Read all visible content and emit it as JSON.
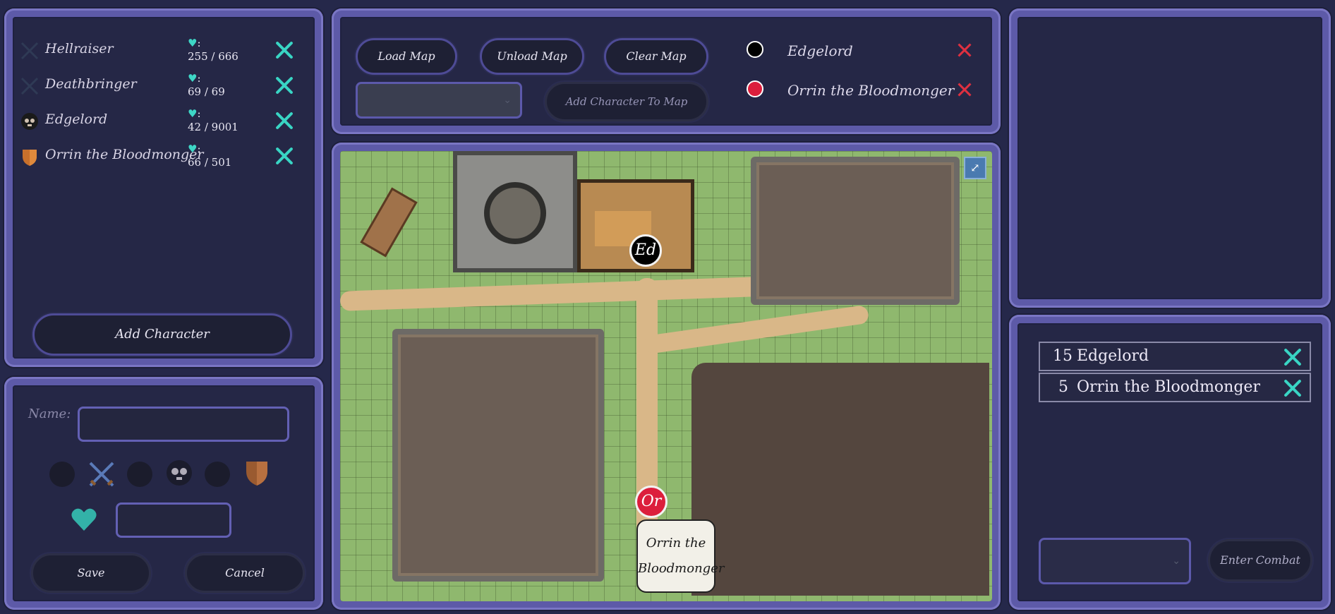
{
  "roster": {
    "items": [
      {
        "name": "Hellraiser",
        "hp_current": "255 / 666",
        "icon": "crossed-swords-icon",
        "hp_label": ":"
      },
      {
        "name": "Deathbringer",
        "hp_current": "69 / 69",
        "icon": "crossed-swords-icon",
        "hp_label": ":"
      },
      {
        "name": "Edgelord",
        "hp_current": "42 / 9001",
        "icon": "skull-icon",
        "hp_label": ":"
      },
      {
        "name": "Orrin the Bloodmonger",
        "hp_current": "66 / 501",
        "icon": "shield-icon",
        "hp_label": ":"
      }
    ],
    "add_button": "Add Character"
  },
  "editor": {
    "name_label": "Name:",
    "name_value": "",
    "hp_value": "",
    "save_label": "Save",
    "cancel_label": "Cancel",
    "icon_options": [
      "circle",
      "crossed-swords-icon",
      "circle",
      "skull-icon",
      "circle",
      "shield-icon"
    ]
  },
  "map_controls": {
    "load_label": "Load Map",
    "unload_label": "Unload Map",
    "clear_label": "Clear Map",
    "select_value": "",
    "add_to_map_label": "Add Character To Map",
    "placed": [
      {
        "name": "Edgelord",
        "color": "#000000"
      },
      {
        "name": "Orrin the Bloodmonger",
        "color": "#dc1e3c"
      }
    ]
  },
  "map": {
    "tokens": [
      {
        "label": "Ed",
        "color": "#000000"
      },
      {
        "label": "Or",
        "color": "#dc1e3c"
      }
    ],
    "tooltip": "Orrin the Bloodmonger",
    "expand_icon": "expand-icon"
  },
  "initiative": {
    "rows": [
      {
        "value": "15",
        "name": "Edgelord"
      },
      {
        "value": "5",
        "name": "Orrin the Bloodmonger"
      }
    ],
    "select_value": "",
    "enter_combat_label": "Enter Combat"
  },
  "colors": {
    "accent": "#5d5aa8",
    "teal": "#39d5c4",
    "background": "#25284a"
  }
}
